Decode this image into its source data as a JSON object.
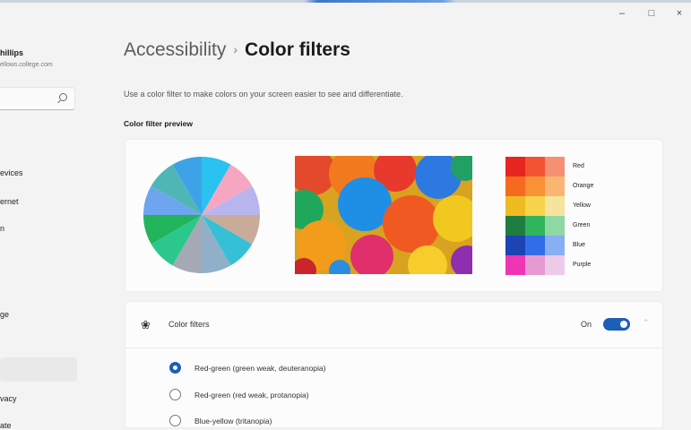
{
  "window": {
    "minimize_glyph": "–",
    "maximize_glyph": "□",
    "close_glyph": "×"
  },
  "profile": {
    "name": "hillips",
    "email": "ellows.college.com"
  },
  "search": {
    "icon": "search-icon"
  },
  "sidebar": {
    "items": [
      {
        "label": "evices"
      },
      {
        "label": "ernet"
      },
      {
        "label": "n"
      },
      {
        "label": "ge"
      },
      {
        "label": ""
      },
      {
        "label": "vacy"
      },
      {
        "label": "ate"
      }
    ],
    "selected_index": 4
  },
  "header": {
    "breadcrumb_parent": "Accessibility",
    "separator": "›",
    "title": "Color filters"
  },
  "description": "Use a color filter to make colors on your screen easier to see and differentiate.",
  "preview": {
    "label": "Color filter preview",
    "pie_colors": [
      "#29c2f1",
      "#f7a6c2",
      "#b8b4ee",
      "#c8ab98",
      "#36c0d6",
      "#8fb0c8",
      "#a5a9b6",
      "#2cc78c",
      "#21b45a",
      "#6ea5ef",
      "#4fb6b5",
      "#3da3e6"
    ],
    "swatches": [
      {
        "label": "Red",
        "colors": [
          "#e7241f",
          "#f35332",
          "#f69072"
        ]
      },
      {
        "label": "Orange",
        "colors": [
          "#f66a1f",
          "#f99234",
          "#f9b672"
        ]
      },
      {
        "label": "Yellow",
        "colors": [
          "#efbb22",
          "#f7d44c",
          "#f5e49d"
        ]
      },
      {
        "label": "Green",
        "colors": [
          "#1f7d42",
          "#2fb55c",
          "#8fd8a3"
        ]
      },
      {
        "label": "Blue",
        "colors": [
          "#1c44b3",
          "#2f6ee7",
          "#88aef3"
        ]
      },
      {
        "label": "Purple",
        "colors": [
          "#ee36b4",
          "#e79ad2",
          "#eccbe8"
        ]
      }
    ]
  },
  "color_filters": {
    "icon": "color-palette-icon",
    "label": "Color filters",
    "toggle_state": "On",
    "options": [
      {
        "label": "Red-green (green weak, deuteranopia)",
        "selected": true
      },
      {
        "label": "Red-green (red weak, protanopia)",
        "selected": false
      },
      {
        "label": "Blue-yellow (tritanopia)",
        "selected": false
      }
    ]
  },
  "accent_color": "#1b5fb8"
}
